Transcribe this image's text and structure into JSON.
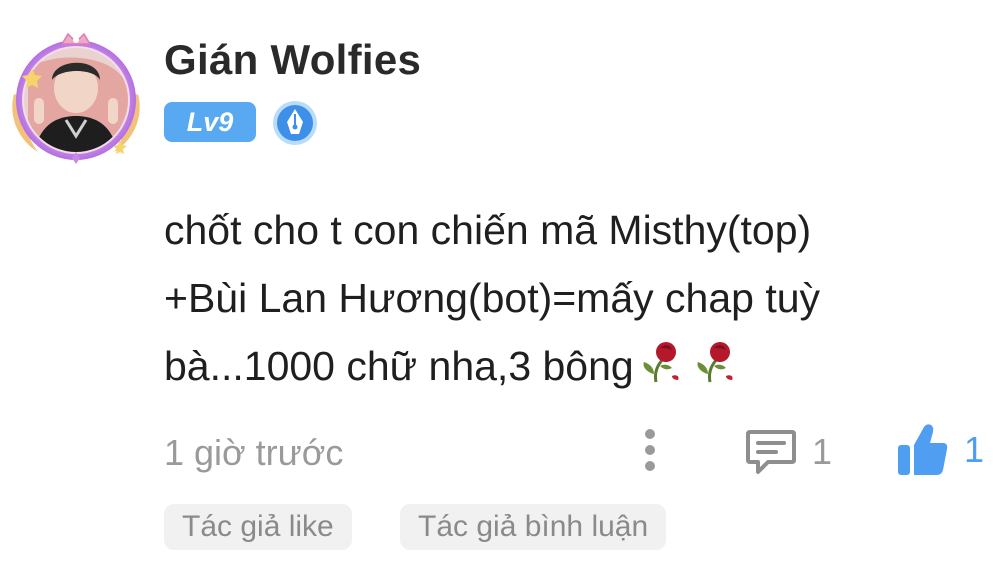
{
  "comment": {
    "author": {
      "name": "Gián Wolfies",
      "level": "Lv9",
      "avatar_icon": "avatar-user-photo",
      "badge_icon": "pen-nib-badge-icon"
    },
    "text_lines": [
      "chốt cho t con chiến mã Misthy(top)",
      "+Bùi Lan Hương(bot)=mấy chap tuỳ",
      "bà...1000 chữ nha,3 bông"
    ],
    "emoji": [
      "wilted-rose-icon",
      "wilted-rose-icon"
    ],
    "timestamp": "1 giờ trước",
    "actions": {
      "more_icon": "vertical-dots-icon",
      "reply_icon": "comment-bubble-icon",
      "reply_count": "1",
      "like_icon": "thumbs-up-icon",
      "like_count": "1"
    },
    "tags": [
      "Tác giả like",
      "Tác giả bình luận"
    ]
  },
  "colors": {
    "accent_blue": "#4f9ef2",
    "level_badge": "#58a8f2",
    "muted_text": "#9a9a9a",
    "tag_background": "#f1f1f1"
  }
}
